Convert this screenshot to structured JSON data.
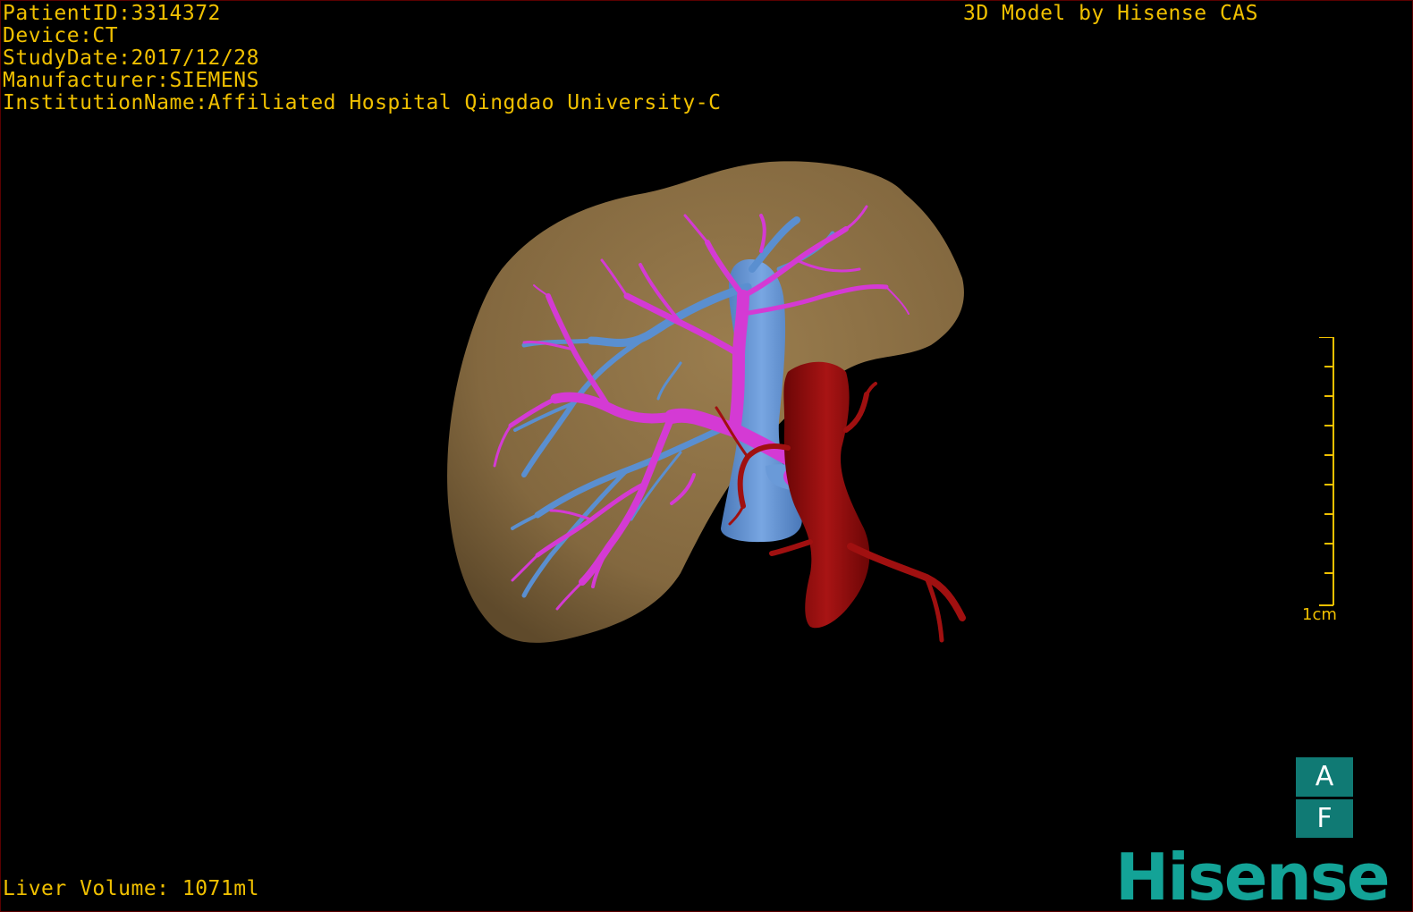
{
  "overlay": {
    "patient_id": "PatientID:3314372",
    "device": "Device:CT",
    "study_date": "StudyDate:2017/12/28",
    "manufacturer": "Manufacturer:SIEMENS",
    "institution": "InstitutionName:Affiliated Hospital Qingdao University-C",
    "model_credit": "3D Model by Hisense CAS",
    "liver_volume": "Liver Volume: 1071ml"
  },
  "scale": {
    "label": "1cm"
  },
  "orientation": {
    "top": "A",
    "bottom": "F"
  },
  "logo": {
    "text": "Hisense"
  },
  "icons": {
    "model": "liver-3d-model-icon",
    "orientation": "orientation-cube-icon"
  },
  "colors": {
    "overlay_text": "#f0c000",
    "liver": "#8b7045",
    "portal_vein": "#d43ad4",
    "hepatic_vein": "#5a8fd0",
    "artery": "#9a0c0c",
    "logo": "#13a397"
  }
}
